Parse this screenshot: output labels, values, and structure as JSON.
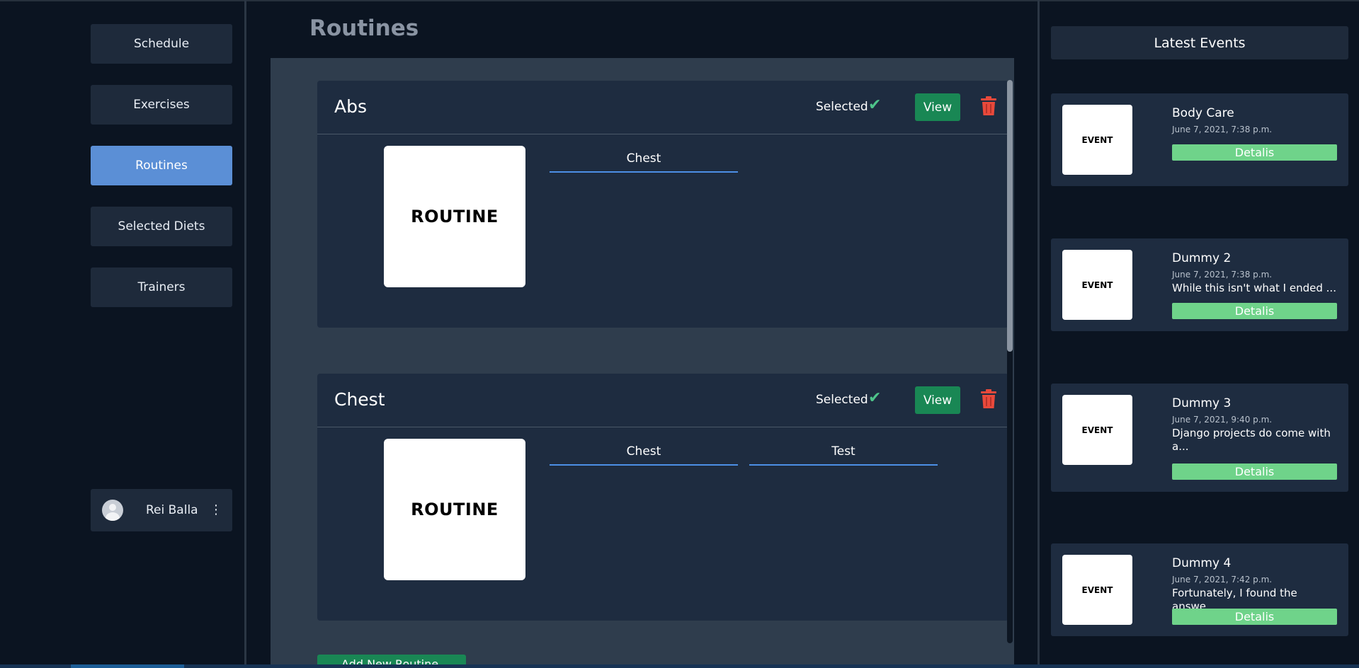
{
  "sidebar": {
    "nav": [
      {
        "label": "Schedule"
      },
      {
        "label": "Exercises"
      },
      {
        "label": "Routines"
      },
      {
        "label": "Selected Diets"
      },
      {
        "label": "Trainers"
      }
    ],
    "active": "Routines",
    "user": {
      "name": "Rei Balla"
    }
  },
  "main": {
    "title": "Routines",
    "routines": [
      {
        "name": "Abs",
        "selected_label": "Selected",
        "view_label": "View",
        "image_text": "ROUTINE",
        "tags": [
          "Chest"
        ]
      },
      {
        "name": "Chest",
        "selected_label": "Selected",
        "view_label": "View",
        "image_text": "ROUTINE",
        "tags": [
          "Chest",
          "Test"
        ]
      }
    ],
    "add_button_label": "Add New Routine"
  },
  "events": {
    "header": "Latest Events",
    "items": [
      {
        "title": "Body Care",
        "date": "June 7, 2021, 7:38 p.m.",
        "desc": "",
        "image_text": "EVENT",
        "button": "Detalis"
      },
      {
        "title": "Dummy 2",
        "date": "June 7, 2021, 7:38 p.m.",
        "desc": "While this isn't what I ended ...",
        "image_text": "EVENT",
        "button": "Detalis"
      },
      {
        "title": "Dummy 3",
        "date": "June 7, 2021, 9:40 p.m.",
        "desc": "Django projects do come with a...",
        "image_text": "EVENT",
        "button": "Detalis"
      },
      {
        "title": "Dummy 4",
        "date": "June 7, 2021, 7:42 p.m.",
        "desc": "Fortunately, I found the answe...",
        "image_text": "EVENT",
        "button": "Detalis"
      }
    ]
  },
  "colors": {
    "background": "#0b1421",
    "card": "#1e2c40",
    "active_nav": "#5b8fd6",
    "view_button": "#198754",
    "details_button": "#6fd38a",
    "delete_icon": "#e8493b",
    "check_icon": "#4ec48a",
    "tag_underline": "#4c8fe6"
  },
  "icons": {
    "selected": "check-icon",
    "delete": "trash-icon",
    "user_menu": "kebab-menu-icon",
    "avatar": "user-avatar-icon"
  }
}
